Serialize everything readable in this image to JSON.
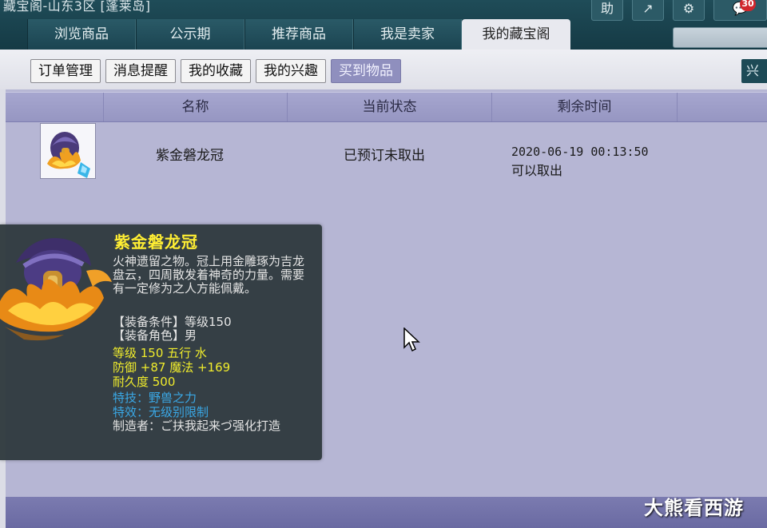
{
  "header": {
    "server_title": "藏宝阁-山东3区 [蓬莱岛]",
    "icons": [
      {
        "name": "help-icon",
        "glyph": "助"
      },
      {
        "name": "share-icon",
        "glyph": "↗"
      },
      {
        "name": "settings-icon",
        "glyph": "⚙"
      },
      {
        "name": "chat-icon",
        "glyph": "💬"
      }
    ],
    "chat_badge": "30",
    "tabs": [
      {
        "label": "浏览商品"
      },
      {
        "label": "公示期"
      },
      {
        "label": "推荐商品"
      },
      {
        "label": "我是卖家"
      },
      {
        "label": "我的藏宝阁",
        "active": true
      }
    ]
  },
  "subnav": {
    "buttons": [
      {
        "label": "订单管理"
      },
      {
        "label": "消息提醒"
      },
      {
        "label": "我的收藏"
      },
      {
        "label": "我的兴趣"
      },
      {
        "label": "买到物品",
        "active": true
      }
    ],
    "edge_label": "兴"
  },
  "table": {
    "columns": [
      "名称",
      "当前状态",
      "剩余时间"
    ],
    "rows": [
      {
        "name": "紫金磐龙冠",
        "status": "已预订未取出",
        "time": "2020-06-19 00:13:50",
        "time_note": "可以取出"
      }
    ]
  },
  "tooltip": {
    "name": "紫金磐龙冠",
    "description": "火神遗留之物。冠上用金雕琢为吉龙盘云，四周散发着神奇的力量。需要有一定修为之人方能佩戴。",
    "req_level": "【装备条件】等级150",
    "req_role": "【装备角色】男",
    "stat_1": "等级 150  五行 水",
    "stat_2": "防御 +87  魔法 +169",
    "stat_3": "耐久度 500",
    "skill": "特技：野兽之力",
    "effect": "特效：无级别限制",
    "maker": "制造者：ご扶我起来づ强化打造"
  },
  "watermark": "大熊看西游"
}
